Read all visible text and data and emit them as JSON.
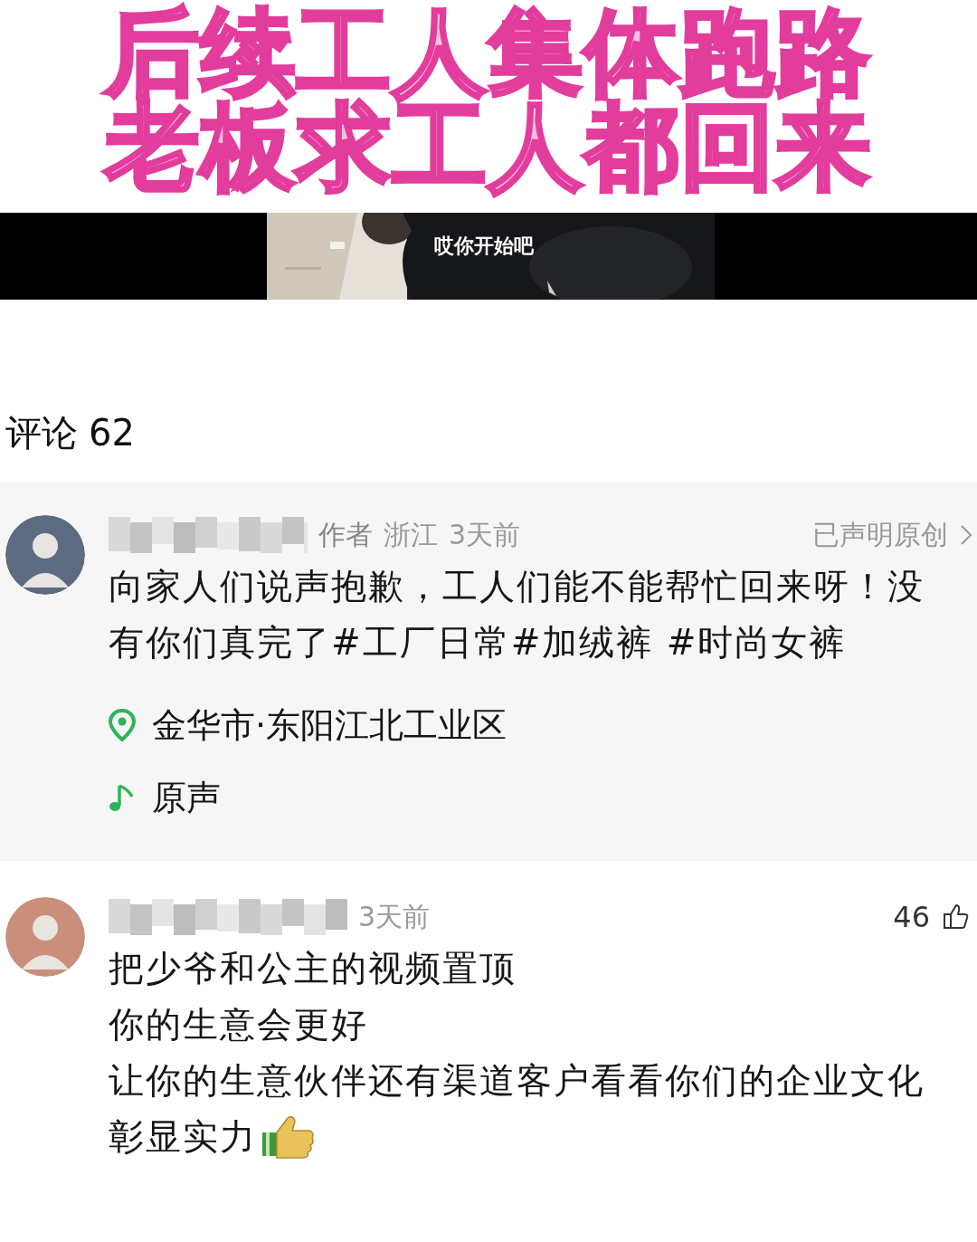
{
  "title_banner": {
    "lines": [
      "后续工人集体跑路",
      "老板求工人都回来"
    ]
  },
  "video": {
    "subtitle": "哎你开始吧"
  },
  "comments_header": {
    "label": "评论",
    "count": "62"
  },
  "comments": [
    {
      "kind": "author_post",
      "author_tag": "作者",
      "region": "浙江",
      "time": "3天前",
      "original_label": "已声明原创",
      "text_lines": [
        "向家人们说声抱歉，工人们能不能帮忙回来呀！没",
        "有你们真完了#工厂日常#加绒裤 #时尚女裤"
      ],
      "location": "金华市·东阳江北工业区",
      "sound": "原声"
    },
    {
      "kind": "reply",
      "time": "3天前",
      "likes": "46",
      "text_lines": [
        "把少爷和公主的视频置顶",
        "你的生意会更好",
        "让你的生意伙伴还有渠道客户看看你们的企业文化",
        "彰显实力"
      ]
    }
  ]
}
